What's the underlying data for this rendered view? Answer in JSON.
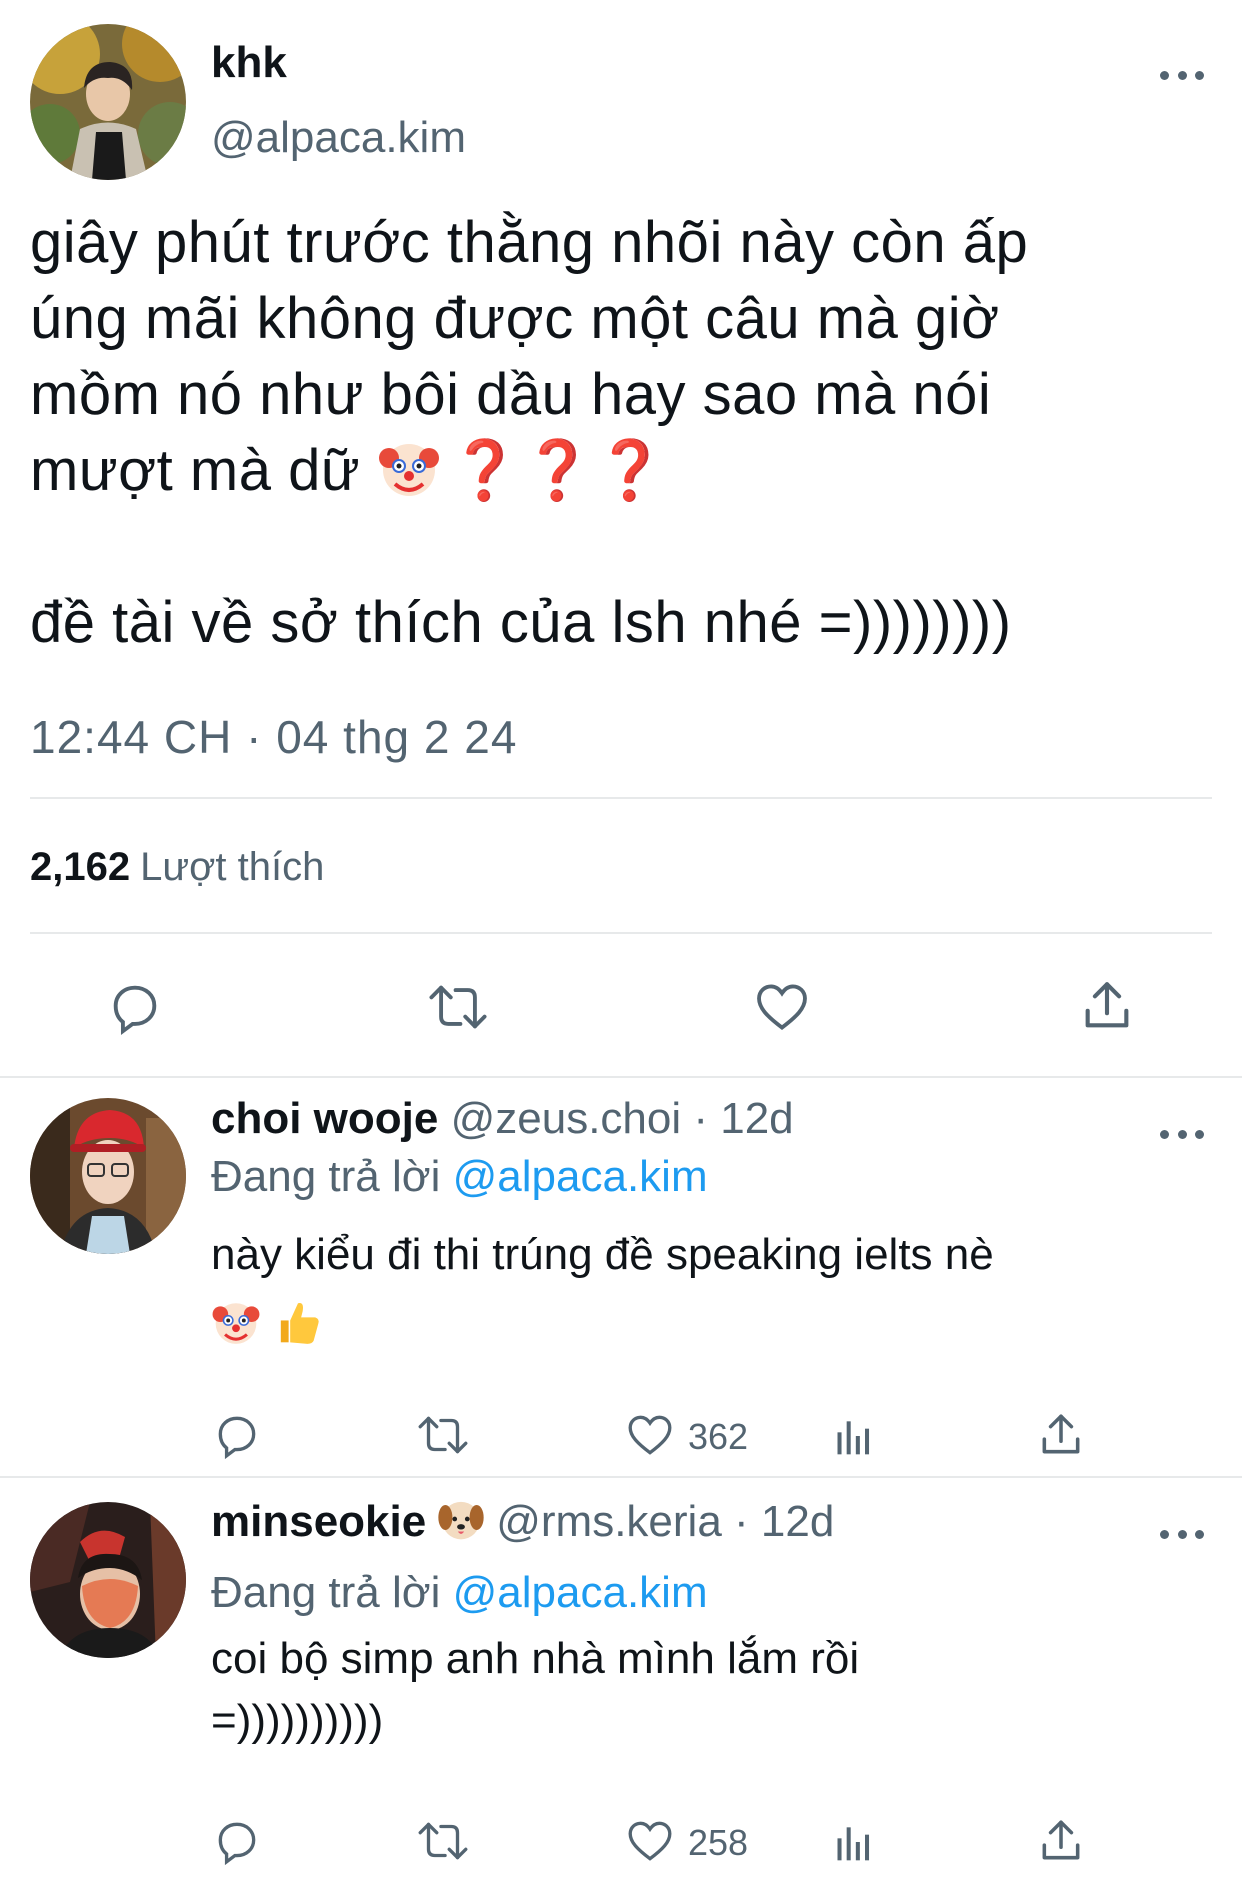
{
  "main_tweet": {
    "author_name": "khk",
    "author_handle": "@alpaca.kim",
    "text_line1": "giây phút trước thằng nhõi này còn ấp",
    "text_line2": "úng mãi không được một câu mà giờ",
    "text_line3": "mồm nó như bôi dầu hay sao mà nói",
    "text_line4": "mượt mà dữ",
    "text_emoji_q": "❓❓❓",
    "text_line5": "đề tài về sở thích của lsh nhé =))))))))",
    "timestamp": "12:44 CH · 04 thg 2 24",
    "likes_count": "2,162",
    "likes_label": "Lượt thích"
  },
  "replies": [
    {
      "name": "choi wooje",
      "handle": "@zeus.choi · 12d",
      "replying_label": "Đang trả lời",
      "replying_to": "@alpaca.kim",
      "text_line1": "này kiểu đi thi trúng đề speaking ielts nè",
      "like_count": "362"
    },
    {
      "name": "minseokie",
      "handle": "@rms.keria · 12d",
      "replying_label": "Đang trả lời",
      "replying_to": "@alpaca.kim",
      "text_line1": "coi bộ simp anh nhà mình lắm rồi",
      "text_line2": "=))))))))))",
      "like_count": "258"
    }
  ],
  "icons": {
    "reply": "reply-bubble-icon",
    "retweet": "retweet-icon",
    "like": "heart-icon",
    "share": "share-icon",
    "views": "analytics-icon",
    "more": "more-dots-icon"
  },
  "colors": {
    "text": "#0f1419",
    "muted": "#536471",
    "mention": "#1d9bf0",
    "divider": "#e7e9ea"
  }
}
